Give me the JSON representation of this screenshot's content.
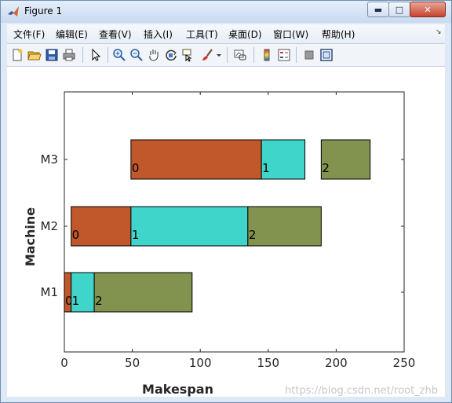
{
  "window": {
    "title": "Figure 1"
  },
  "window_controls": {
    "minimize": "▬",
    "maximize": "□",
    "close": "✕"
  },
  "menu": {
    "items": [
      "文件(F)",
      "编辑(E)",
      "查看(V)",
      "插入(I)",
      "工具(T)",
      "桌面(D)",
      "窗口(W)",
      "帮助(H)"
    ],
    "overflow_arrow": "↘"
  },
  "toolbar": {
    "icons": [
      "new-figure-icon",
      "open-file-icon",
      "save-icon",
      "print-icon",
      "select-arrow-icon",
      "zoom-in-icon",
      "zoom-out-icon",
      "pan-hand-icon",
      "rotate-3d-icon",
      "data-cursor-icon",
      "brush-icon",
      "brush-dropdown-icon",
      "link-plot-icon",
      "colorbar-icon",
      "legend-icon",
      "hide-plot-tools-icon",
      "show-plot-tools-icon"
    ]
  },
  "colors": {
    "job0": "#c0582b",
    "job1": "#40d5cb",
    "job2": "#82924f"
  },
  "chart_data": {
    "type": "bar",
    "orientation": "horizontal-gantt",
    "xlabel": "Makespan",
    "ylabel": "Machine",
    "xlim": [
      0,
      250
    ],
    "xticks": [
      0,
      50,
      100,
      150,
      200,
      250
    ],
    "categories": [
      "M1",
      "M2",
      "M3"
    ],
    "grid": false,
    "series": [
      {
        "machine": "M3",
        "job": "0",
        "start": 49,
        "end": 145
      },
      {
        "machine": "M3",
        "job": "1",
        "start": 145,
        "end": 177
      },
      {
        "machine": "M3",
        "job": "2",
        "start": 189,
        "end": 225
      },
      {
        "machine": "M2",
        "job": "0",
        "start": 5,
        "end": 49
      },
      {
        "machine": "M2",
        "job": "1",
        "start": 49,
        "end": 135
      },
      {
        "machine": "M2",
        "job": "2",
        "start": 135,
        "end": 189
      },
      {
        "machine": "M1",
        "job": "0",
        "start": 0,
        "end": 5
      },
      {
        "machine": "M1",
        "job": "1",
        "start": 5,
        "end": 22
      },
      {
        "machine": "M1",
        "job": "2",
        "start": 22,
        "end": 94
      }
    ]
  },
  "watermark": "https://blog.csdn.net/root_zhb"
}
